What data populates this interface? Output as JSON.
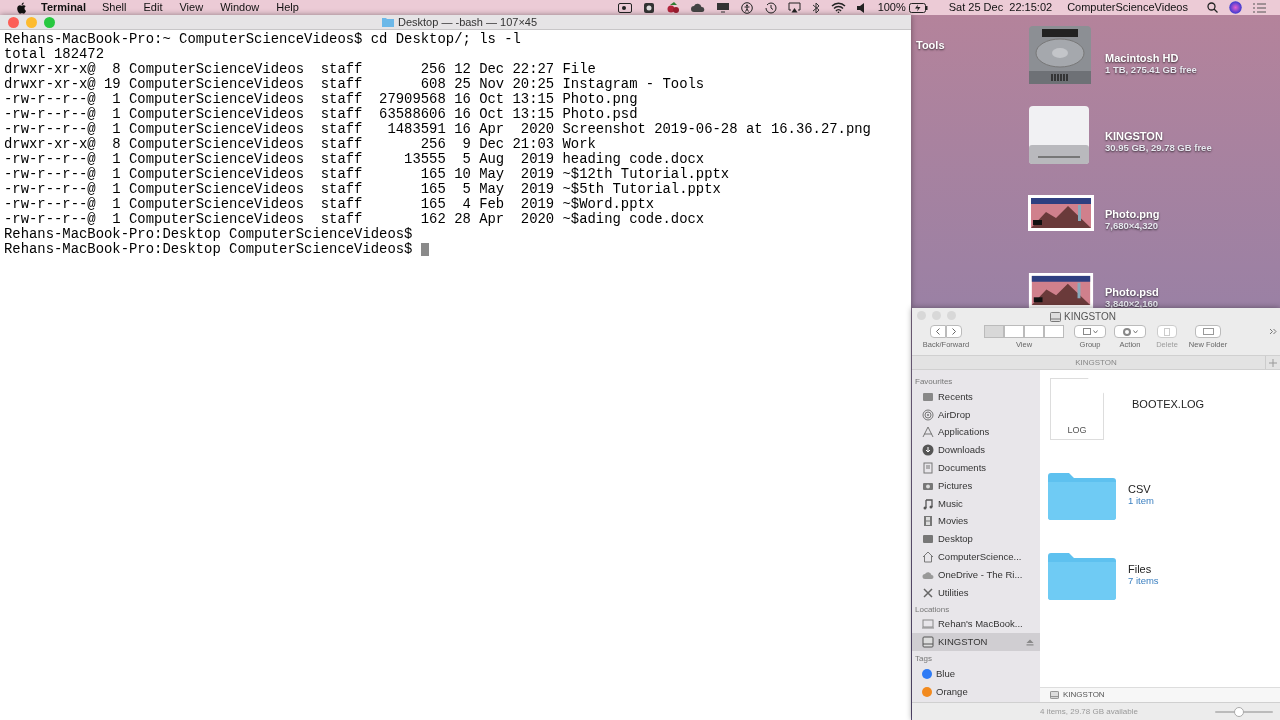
{
  "menu_bar": {
    "app_name": "Terminal",
    "menus": [
      "Shell",
      "Edit",
      "View",
      "Window",
      "Help"
    ],
    "battery": "100%",
    "clock": "Sat 25 Dec  22:15:02",
    "user": "ComputerScienceVideos"
  },
  "terminal": {
    "title": "Desktop — -bash — 107×45",
    "lines": [
      "Rehans-MacBook-Pro:~ ComputerScienceVideos$ cd Desktop/; ls -l",
      "total 182472",
      "drwxr-xr-x@  8 ComputerScienceVideos  staff       256 12 Dec 22:27 File",
      "drwxr-xr-x@ 19 ComputerScienceVideos  staff       608 25 Nov 20:25 Instagram - Tools",
      "-rw-r--r--@  1 ComputerScienceVideos  staff  27909568 16 Oct 13:15 Photo.png",
      "-rw-r--r--@  1 ComputerScienceVideos  staff  63588606 16 Oct 13:15 Photo.psd",
      "-rw-r--r--@  1 ComputerScienceVideos  staff   1483591 16 Apr  2020 Screenshot 2019-06-28 at 16.36.27.png",
      "drwxr-xr-x@  8 ComputerScienceVideos  staff       256  9 Dec 21:03 Work",
      "-rw-r--r--@  1 ComputerScienceVideos  staff     13555  5 Aug  2019 heading code.docx",
      "-rw-r--r--@  1 ComputerScienceVideos  staff       165 10 May  2019 ~$12th Tutorial.pptx",
      "-rw-r--r--@  1 ComputerScienceVideos  staff       165  5 May  2019 ~$5th Tutorial.pptx",
      "-rw-r--r--@  1 ComputerScienceVideos  staff       165  4 Feb  2019 ~$Word.pptx",
      "-rw-r--r--@  1 ComputerScienceVideos  staff       162 28 Apr  2020 ~$ading code.docx",
      "Rehans-MacBook-Pro:Desktop ComputerScienceVideos$"
    ],
    "prompt": "Rehans-MacBook-Pro:Desktop ComputerScienceVideos$"
  },
  "desktop_items": [
    {
      "kind": "folder_cut",
      "name": "Tools"
    },
    {
      "kind": "hard_disk",
      "name": "Macintosh HD",
      "detail": "1 TB, 275.41 GB free"
    },
    {
      "kind": "usb_drive",
      "name": "KINGSTON",
      "detail": "30.95 GB, 29.78 GB free"
    },
    {
      "kind": "image",
      "name": "Photo.png",
      "detail": "7,680×4,320"
    },
    {
      "kind": "image",
      "name": "Photo.psd",
      "detail": "3,840×2,160"
    }
  ],
  "finder": {
    "title": "KINGSTON",
    "toolbar": [
      {
        "label": "Back/Forward",
        "kind": "nav",
        "disabled": false
      },
      {
        "label": "View",
        "kind": "view",
        "disabled": false
      },
      {
        "label": "Group",
        "kind": "group",
        "disabled": false
      },
      {
        "label": "Action",
        "kind": "action",
        "disabled": false
      },
      {
        "label": "Delete",
        "kind": "trash",
        "disabled": true
      },
      {
        "label": "New Folder",
        "kind": "new_folder",
        "disabled": false
      }
    ],
    "path_tab": "KINGSTON",
    "sidebar": [
      {
        "heading": "Favourites",
        "items": [
          {
            "label": "Recents",
            "selected": false
          },
          {
            "label": "AirDrop",
            "selected": false
          },
          {
            "label": "Applications",
            "selected": false
          },
          {
            "label": "Downloads",
            "selected": false
          },
          {
            "label": "Documents",
            "selected": false
          },
          {
            "label": "Pictures",
            "selected": false
          },
          {
            "label": "Music",
            "selected": false
          },
          {
            "label": "Movies",
            "selected": false
          },
          {
            "label": "Desktop",
            "selected": false
          },
          {
            "label": "ComputerScience...",
            "selected": false
          },
          {
            "label": "OneDrive - The Ri...",
            "selected": false
          },
          {
            "label": "Utilities",
            "selected": false
          }
        ]
      },
      {
        "heading": "Locations",
        "items": [
          {
            "label": "Rehan's MacBook...",
            "selected": false
          },
          {
            "label": "KINGSTON",
            "selected": true,
            "ejectable": true
          }
        ]
      },
      {
        "heading": "Tags",
        "items": [
          {
            "label": "Blue",
            "color": "#2f7bf5",
            "selected": false
          },
          {
            "label": "Orange",
            "color": "#f28a1e",
            "selected": false
          }
        ]
      }
    ],
    "files": [
      {
        "kind": "document",
        "name": "BOOTEX.LOG",
        "badge": "LOG"
      },
      {
        "kind": "folder",
        "name": "CSV",
        "detail": "1 item"
      },
      {
        "kind": "folder",
        "name": "Files",
        "detail": "7 items"
      }
    ],
    "path_bar": "KINGSTON",
    "status": "4 items, 29.78 GB available",
    "zoom_slider": {
      "level": 0.4
    }
  }
}
